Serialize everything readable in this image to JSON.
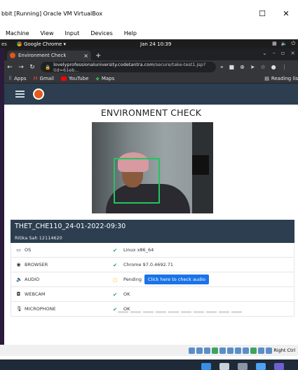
{
  "vbox": {
    "title": "bbit [Running]   Oracle VM VirtualBox",
    "menu": [
      "Machine",
      "View",
      "Input",
      "Devices",
      "Help"
    ],
    "status_text": "Right Ctrl"
  },
  "gnome": {
    "activities": "es",
    "app": "Google Chrome ▾",
    "clock": "Jan 24  10:39"
  },
  "browser": {
    "tab_title": "Environment Check",
    "url_host": "lovelyprofessionaluniversity.codetantra.com",
    "url_path": "/secure/take-test1.jsp?tid=61eb...",
    "bookmarks": [
      "Apps",
      "Gmail",
      "YouTube",
      "Maps"
    ],
    "reading_list": "Reading lis"
  },
  "page": {
    "title": "ENVIRONMENT CHECK",
    "test_name": "THET_CHE110_24-01-2022-09:30",
    "user": "Ritika Sah 12114620",
    "checks": [
      {
        "label": "OS",
        "icon": "monitor-icon",
        "status": "✔",
        "value": "Linux x86_64"
      },
      {
        "label": "BROWSER",
        "icon": "globe-icon",
        "status": "✔",
        "value": "Chrome 97.0.4692.71"
      },
      {
        "label": "AUDIO",
        "icon": "speaker-icon",
        "status": "○",
        "value": "Pending",
        "button": "Click here to check audio"
      },
      {
        "label": "WEBCAM",
        "icon": "camera-icon",
        "status": "✔",
        "value": "OK"
      },
      {
        "label": "MICROPHONE",
        "icon": "microphone-icon",
        "status": "✔",
        "value": "OK"
      }
    ]
  }
}
